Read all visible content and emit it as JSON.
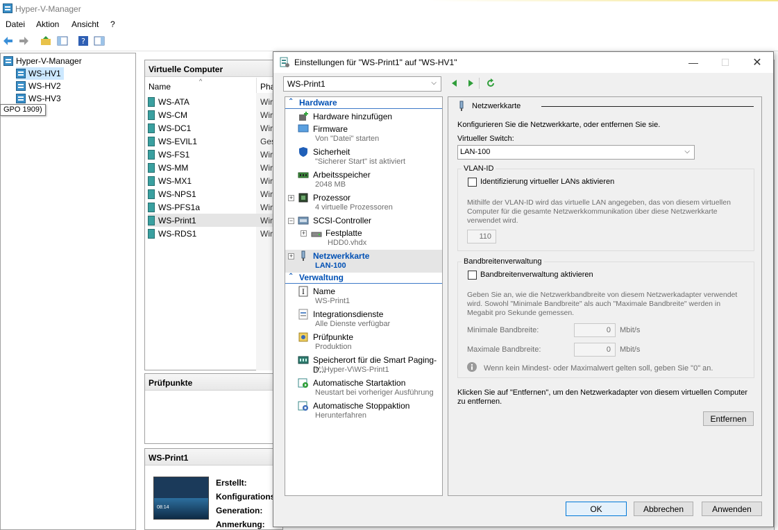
{
  "main": {
    "title": "Hyper-V-Manager",
    "menu": [
      "Datei",
      "Aktion",
      "Ansicht",
      "?"
    ],
    "tree": {
      "root": "Hyper-V-Manager",
      "hosts": [
        "WS-HV1",
        "WS-HV2",
        "WS-HV3"
      ]
    },
    "tooltip": "GPO 1909)",
    "vm_pane": {
      "title": "Virtuelle Computer",
      "col_name": "Name",
      "col_phase": "Pha",
      "rows": [
        {
          "name": "WS-ATA",
          "phase": "Wird"
        },
        {
          "name": "WS-CM",
          "phase": "Wird"
        },
        {
          "name": "WS-DC1",
          "phase": "Wird"
        },
        {
          "name": "WS-EVIL1",
          "phase": "Ges"
        },
        {
          "name": "WS-FS1",
          "phase": "Wird"
        },
        {
          "name": "WS-MM",
          "phase": "Wird"
        },
        {
          "name": "WS-MX1",
          "phase": "Wird"
        },
        {
          "name": "WS-NPS1",
          "phase": "Wird"
        },
        {
          "name": "WS-PFS1a",
          "phase": "Wird"
        },
        {
          "name": "WS-Print1",
          "phase": "Wird"
        },
        {
          "name": "WS-RDS1",
          "phase": "Wird"
        }
      ]
    },
    "checkpoints_pane": {
      "title": "Prüfpunkte"
    },
    "details_pane": {
      "title": "WS-Print1",
      "labels": [
        "Erstellt:",
        "Konfigurations",
        "Generation:",
        "Anmerkung:"
      ],
      "thumb_time": "08:14"
    }
  },
  "dialog": {
    "title": "Einstellungen für \"WS-Print1\" auf \"WS-HV1\"",
    "vm_select": "WS-Print1",
    "nav": {
      "hardware_header": "Hardware",
      "items": [
        {
          "label": "Hardware hinzufügen",
          "sub": ""
        },
        {
          "label": "Firmware",
          "sub": "Von \"Datei\" starten"
        },
        {
          "label": "Sicherheit",
          "sub": "\"Sicherer Start\" ist aktiviert"
        },
        {
          "label": "Arbeitsspeicher",
          "sub": "2048 MB"
        },
        {
          "label": "Prozessor",
          "sub": "4 virtuelle Prozessoren"
        },
        {
          "label": "SCSI-Controller",
          "sub": ""
        },
        {
          "label": "Festplatte",
          "sub": "HDD0.vhdx"
        },
        {
          "label": "Netzwerkkarte",
          "sub": "LAN-100"
        }
      ],
      "management_header": "Verwaltung",
      "mgmt_items": [
        {
          "label": "Name",
          "sub": "WS-Print1"
        },
        {
          "label": "Integrationsdienste",
          "sub": "Alle Dienste verfügbar"
        },
        {
          "label": "Prüfpunkte",
          "sub": "Produktion"
        },
        {
          "label": "Speicherort für die Smart Paging-D...",
          "sub": "V:\\Hyper-V\\WS-Print1"
        },
        {
          "label": "Automatische Startaktion",
          "sub": "Neustart bei vorheriger Ausführung"
        },
        {
          "label": "Automatische Stoppaktion",
          "sub": "Herunterfahren"
        }
      ]
    },
    "settings": {
      "section_title": "Netzwerkkarte",
      "intro": "Konfigurieren Sie die Netzwerkkarte, oder entfernen Sie sie.",
      "switch_label": "Virtueller Switch:",
      "switch_value": "LAN-100",
      "vlan_group": "VLAN-ID",
      "vlan_checkbox": "Identifizierung virtueller LANs aktivieren",
      "vlan_desc": "Mithilfe der VLAN-ID wird das virtuelle LAN angegeben, das von diesem virtuellen Computer für die gesamte Netzwerkkommunikation über diese Netzwerkkarte verwendet wird.",
      "vlan_value": "110",
      "bw_group": "Bandbreitenverwaltung",
      "bw_checkbox": "Bandbreitenverwaltung aktivieren",
      "bw_desc": "Geben Sie an, wie die Netzwerkbandbreite von diesem Netzwerkadapter verwendet wird. Sowohl \"Minimale Bandbreite\" als auch \"Maximale Bandbreite\" werden in Megabit pro Sekunde gemessen.",
      "min_label": "Minimale Bandbreite:",
      "min_value": "0",
      "max_label": "Maximale Bandbreite:",
      "max_value": "0",
      "unit": "Mbit/s",
      "info": "Wenn kein Mindest- oder Maximalwert gelten soll, geben Sie \"0\" an.",
      "remove_text": "Klicken Sie auf \"Entfernen\", um den Netzwerkadapter von diesem virtuellen Computer zu entfernen.",
      "remove_button": "Entfernen"
    },
    "buttons": {
      "ok": "OK",
      "cancel": "Abbrechen",
      "apply": "Anwenden"
    }
  },
  "colors": {
    "accent": "#0050b4",
    "selection": "#cce8ff"
  }
}
